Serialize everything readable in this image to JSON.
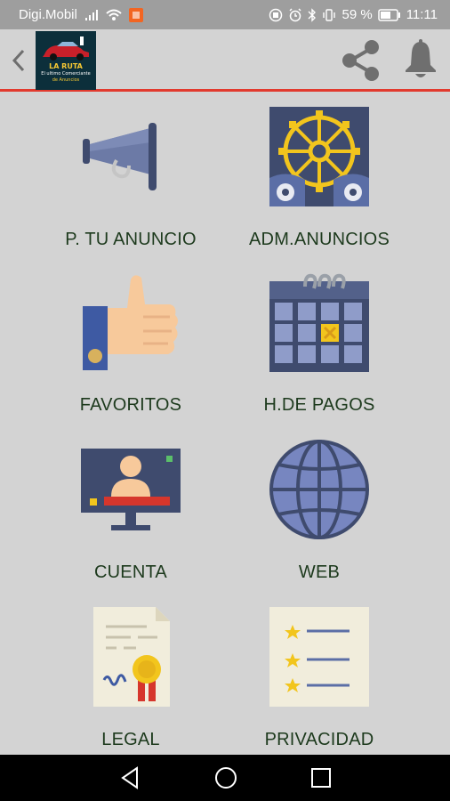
{
  "status_bar": {
    "carrier": "Digi.Mobil",
    "battery": "59 %",
    "time": "11:11"
  },
  "app_bar": {
    "logo_title": "LA RUTA",
    "logo_subtitle": "El ultimo Comerciante",
    "logo_subtitle2": "de Anuncios"
  },
  "menu": {
    "items": [
      {
        "label": "P. TU ANUNCIO",
        "icon": "megaphone-icon"
      },
      {
        "label": "ADM.ANUNCIOS",
        "icon": "gear-icon"
      },
      {
        "label": "FAVORITOS",
        "icon": "thumbs-up-icon"
      },
      {
        "label": "H.DE PAGOS",
        "icon": "calendar-icon"
      },
      {
        "label": "CUENTA",
        "icon": "monitor-user-icon"
      },
      {
        "label": "WEB",
        "icon": "globe-icon"
      },
      {
        "label": "LEGAL",
        "icon": "certificate-icon"
      },
      {
        "label": "PRIVACIDAD",
        "icon": "checklist-icon"
      }
    ]
  },
  "colors": {
    "background": "#d3d3d3",
    "status_bar": "#9e9e9e",
    "accent_line": "#e23a2e",
    "label_text": "#1d3a1d",
    "icon_blue": "#3f4b6e",
    "icon_yellow": "#f2c51d"
  }
}
